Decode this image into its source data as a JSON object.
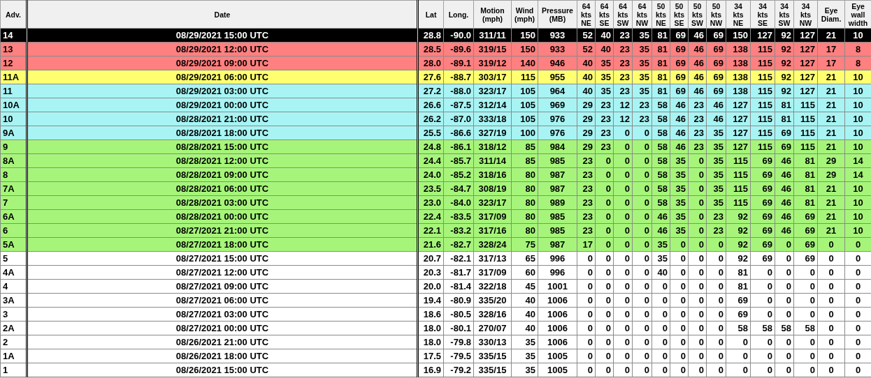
{
  "table": {
    "columns": [
      "Adv.",
      "Date",
      "Lat",
      "Long.",
      "Motion\n(mph)",
      "Wind\n(mph)",
      "Pressure\n(MB)",
      "64\nkts\nNE",
      "64\nkts\nSE",
      "64\nkts\nSW",
      "64\nkts\nNW",
      "50\nkts\nNE",
      "50\nkts\nSE",
      "50\nkts\nSW",
      "50\nkts\nNW",
      "34\nkts\nNE",
      "34\nkts\nSE",
      "34\nkts\nSW",
      "34\nkts\nNW",
      "Eye\nDiam.",
      "Eye\nwall\nwidth"
    ],
    "rows": [
      {
        "selected": true,
        "cells": [
          "14",
          "08/29/2021 15:00 UTC",
          "28.8",
          "-90.0",
          "311/11",
          "150",
          "933",
          "52",
          "40",
          "23",
          "35",
          "81",
          "69",
          "46",
          "69",
          "150",
          "127",
          "92",
          "127",
          "21",
          "10"
        ]
      },
      {
        "selected": false,
        "color": "#ff8080",
        "cells": [
          "13",
          "08/29/2021 12:00 UTC",
          "28.5",
          "-89.6",
          "319/15",
          "150",
          "933",
          "52",
          "40",
          "23",
          "35",
          "81",
          "69",
          "46",
          "69",
          "138",
          "115",
          "92",
          "127",
          "17",
          "8"
        ]
      },
      {
        "selected": false,
        "color": "#ff8080",
        "cells": [
          "12",
          "08/29/2021 09:00 UTC",
          "28.0",
          "-89.1",
          "319/12",
          "140",
          "946",
          "40",
          "35",
          "23",
          "35",
          "81",
          "69",
          "46",
          "69",
          "138",
          "115",
          "92",
          "127",
          "17",
          "8"
        ]
      },
      {
        "selected": false,
        "color": "#ffff70",
        "cells": [
          "11A",
          "08/29/2021 06:00 UTC",
          "27.6",
          "-88.7",
          "303/17",
          "115",
          "955",
          "40",
          "35",
          "23",
          "35",
          "81",
          "69",
          "46",
          "69",
          "138",
          "115",
          "92",
          "127",
          "21",
          "10"
        ]
      },
      {
        "selected": false,
        "color": "#a8f4f4",
        "cells": [
          "11",
          "08/29/2021 03:00 UTC",
          "27.2",
          "-88.0",
          "323/17",
          "105",
          "964",
          "40",
          "35",
          "23",
          "35",
          "81",
          "69",
          "46",
          "69",
          "138",
          "115",
          "92",
          "127",
          "21",
          "10"
        ]
      },
      {
        "selected": false,
        "color": "#a8f4f4",
        "cells": [
          "10A",
          "08/29/2021 00:00 UTC",
          "26.6",
          "-87.5",
          "312/14",
          "105",
          "969",
          "29",
          "23",
          "12",
          "23",
          "58",
          "46",
          "23",
          "46",
          "127",
          "115",
          "81",
          "115",
          "21",
          "10"
        ]
      },
      {
        "selected": false,
        "color": "#a8f4f4",
        "cells": [
          "10",
          "08/28/2021 21:00 UTC",
          "26.2",
          "-87.0",
          "333/18",
          "105",
          "976",
          "29",
          "23",
          "12",
          "23",
          "58",
          "46",
          "23",
          "46",
          "127",
          "115",
          "81",
          "115",
          "21",
          "10"
        ]
      },
      {
        "selected": false,
        "color": "#a8f4f4",
        "cells": [
          "9A",
          "08/28/2021 18:00 UTC",
          "25.5",
          "-86.6",
          "327/19",
          "100",
          "976",
          "29",
          "23",
          "0",
          "0",
          "58",
          "46",
          "23",
          "35",
          "127",
          "115",
          "69",
          "115",
          "21",
          "10"
        ]
      },
      {
        "selected": false,
        "color": "#a6f57a",
        "cells": [
          "9",
          "08/28/2021 15:00 UTC",
          "24.8",
          "-86.1",
          "318/12",
          "85",
          "984",
          "29",
          "23",
          "0",
          "0",
          "58",
          "46",
          "23",
          "35",
          "127",
          "115",
          "69",
          "115",
          "21",
          "10"
        ]
      },
      {
        "selected": false,
        "color": "#a6f57a",
        "cells": [
          "8A",
          "08/28/2021 12:00 UTC",
          "24.4",
          "-85.7",
          "311/14",
          "85",
          "985",
          "23",
          "0",
          "0",
          "0",
          "58",
          "35",
          "0",
          "35",
          "115",
          "69",
          "46",
          "81",
          "29",
          "14"
        ]
      },
      {
        "selected": false,
        "color": "#a6f57a",
        "cells": [
          "8",
          "08/28/2021 09:00 UTC",
          "24.0",
          "-85.2",
          "318/16",
          "80",
          "987",
          "23",
          "0",
          "0",
          "0",
          "58",
          "35",
          "0",
          "35",
          "115",
          "69",
          "46",
          "81",
          "29",
          "14"
        ]
      },
      {
        "selected": false,
        "color": "#a6f57a",
        "cells": [
          "7A",
          "08/28/2021 06:00 UTC",
          "23.5",
          "-84.7",
          "308/19",
          "80",
          "987",
          "23",
          "0",
          "0",
          "0",
          "58",
          "35",
          "0",
          "35",
          "115",
          "69",
          "46",
          "81",
          "21",
          "10"
        ]
      },
      {
        "selected": false,
        "color": "#a6f57a",
        "cells": [
          "7",
          "08/28/2021 03:00 UTC",
          "23.0",
          "-84.0",
          "323/17",
          "80",
          "989",
          "23",
          "0",
          "0",
          "0",
          "58",
          "35",
          "0",
          "35",
          "115",
          "69",
          "46",
          "81",
          "21",
          "10"
        ]
      },
      {
        "selected": false,
        "color": "#a6f57a",
        "cells": [
          "6A",
          "08/28/2021 00:00 UTC",
          "22.4",
          "-83.5",
          "317/09",
          "80",
          "985",
          "23",
          "0",
          "0",
          "0",
          "46",
          "35",
          "0",
          "23",
          "92",
          "69",
          "46",
          "69",
          "21",
          "10"
        ]
      },
      {
        "selected": false,
        "color": "#a6f57a",
        "cells": [
          "6",
          "08/27/2021 21:00 UTC",
          "22.1",
          "-83.2",
          "317/16",
          "80",
          "985",
          "23",
          "0",
          "0",
          "0",
          "46",
          "35",
          "0",
          "23",
          "92",
          "69",
          "46",
          "69",
          "21",
          "10"
        ]
      },
      {
        "selected": false,
        "color": "#a6f57a",
        "cells": [
          "5A",
          "08/27/2021 18:00 UTC",
          "21.6",
          "-82.7",
          "328/24",
          "75",
          "987",
          "17",
          "0",
          "0",
          "0",
          "35",
          "0",
          "0",
          "0",
          "92",
          "69",
          "0",
          "69",
          "0",
          "0"
        ]
      },
      {
        "selected": false,
        "color": "#ffffff",
        "cells": [
          "5",
          "08/27/2021 15:00 UTC",
          "20.7",
          "-82.1",
          "317/13",
          "65",
          "996",
          "0",
          "0",
          "0",
          "0",
          "35",
          "0",
          "0",
          "0",
          "92",
          "69",
          "0",
          "69",
          "0",
          "0"
        ]
      },
      {
        "selected": false,
        "color": "#ffffff",
        "cells": [
          "4A",
          "08/27/2021 12:00 UTC",
          "20.3",
          "-81.7",
          "317/09",
          "60",
          "996",
          "0",
          "0",
          "0",
          "0",
          "40",
          "0",
          "0",
          "0",
          "81",
          "0",
          "0",
          "0",
          "0",
          "0"
        ]
      },
      {
        "selected": false,
        "color": "#ffffff",
        "cells": [
          "4",
          "08/27/2021 09:00 UTC",
          "20.0",
          "-81.4",
          "322/18",
          "45",
          "1001",
          "0",
          "0",
          "0",
          "0",
          "0",
          "0",
          "0",
          "0",
          "81",
          "0",
          "0",
          "0",
          "0",
          "0"
        ]
      },
      {
        "selected": false,
        "color": "#ffffff",
        "cells": [
          "3A",
          "08/27/2021 06:00 UTC",
          "19.4",
          "-80.9",
          "335/20",
          "40",
          "1006",
          "0",
          "0",
          "0",
          "0",
          "0",
          "0",
          "0",
          "0",
          "69",
          "0",
          "0",
          "0",
          "0",
          "0"
        ]
      },
      {
        "selected": false,
        "color": "#ffffff",
        "cells": [
          "3",
          "08/27/2021 03:00 UTC",
          "18.6",
          "-80.5",
          "328/16",
          "40",
          "1006",
          "0",
          "0",
          "0",
          "0",
          "0",
          "0",
          "0",
          "0",
          "69",
          "0",
          "0",
          "0",
          "0",
          "0"
        ]
      },
      {
        "selected": false,
        "color": "#ffffff",
        "cells": [
          "2A",
          "08/27/2021 00:00 UTC",
          "18.0",
          "-80.1",
          "270/07",
          "40",
          "1006",
          "0",
          "0",
          "0",
          "0",
          "0",
          "0",
          "0",
          "0",
          "58",
          "58",
          "58",
          "58",
          "0",
          "0"
        ]
      },
      {
        "selected": false,
        "color": "#ffffff",
        "cells": [
          "2",
          "08/26/2021 21:00 UTC",
          "18.0",
          "-79.8",
          "330/13",
          "35",
          "1006",
          "0",
          "0",
          "0",
          "0",
          "0",
          "0",
          "0",
          "0",
          "0",
          "0",
          "0",
          "0",
          "0",
          "0"
        ]
      },
      {
        "selected": false,
        "color": "#ffffff",
        "cells": [
          "1A",
          "08/26/2021 18:00 UTC",
          "17.5",
          "-79.5",
          "335/15",
          "35",
          "1005",
          "0",
          "0",
          "0",
          "0",
          "0",
          "0",
          "0",
          "0",
          "0",
          "0",
          "0",
          "0",
          "0",
          "0"
        ]
      },
      {
        "selected": false,
        "color": "#ffffff",
        "cells": [
          "1",
          "08/26/2021 15:00 UTC",
          "16.9",
          "-79.2",
          "335/15",
          "35",
          "1005",
          "0",
          "0",
          "0",
          "0",
          "0",
          "0",
          "0",
          "0",
          "0",
          "0",
          "0",
          "0",
          "0",
          "0"
        ]
      }
    ]
  }
}
